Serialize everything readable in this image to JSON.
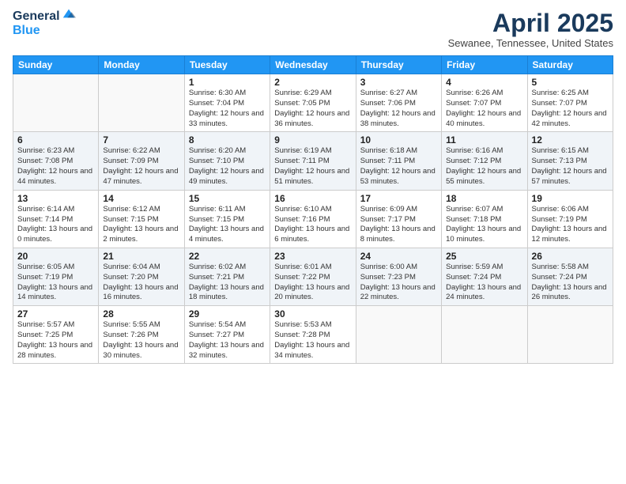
{
  "logo": {
    "general": "General",
    "blue": "Blue"
  },
  "header": {
    "title": "April 2025",
    "subtitle": "Sewanee, Tennessee, United States"
  },
  "weekdays": [
    "Sunday",
    "Monday",
    "Tuesday",
    "Wednesday",
    "Thursday",
    "Friday",
    "Saturday"
  ],
  "weeks": [
    [
      {
        "day": "",
        "info": ""
      },
      {
        "day": "",
        "info": ""
      },
      {
        "day": "1",
        "info": "Sunrise: 6:30 AM\nSunset: 7:04 PM\nDaylight: 12 hours and 33 minutes."
      },
      {
        "day": "2",
        "info": "Sunrise: 6:29 AM\nSunset: 7:05 PM\nDaylight: 12 hours and 36 minutes."
      },
      {
        "day": "3",
        "info": "Sunrise: 6:27 AM\nSunset: 7:06 PM\nDaylight: 12 hours and 38 minutes."
      },
      {
        "day": "4",
        "info": "Sunrise: 6:26 AM\nSunset: 7:07 PM\nDaylight: 12 hours and 40 minutes."
      },
      {
        "day": "5",
        "info": "Sunrise: 6:25 AM\nSunset: 7:07 PM\nDaylight: 12 hours and 42 minutes."
      }
    ],
    [
      {
        "day": "6",
        "info": "Sunrise: 6:23 AM\nSunset: 7:08 PM\nDaylight: 12 hours and 44 minutes."
      },
      {
        "day": "7",
        "info": "Sunrise: 6:22 AM\nSunset: 7:09 PM\nDaylight: 12 hours and 47 minutes."
      },
      {
        "day": "8",
        "info": "Sunrise: 6:20 AM\nSunset: 7:10 PM\nDaylight: 12 hours and 49 minutes."
      },
      {
        "day": "9",
        "info": "Sunrise: 6:19 AM\nSunset: 7:11 PM\nDaylight: 12 hours and 51 minutes."
      },
      {
        "day": "10",
        "info": "Sunrise: 6:18 AM\nSunset: 7:11 PM\nDaylight: 12 hours and 53 minutes."
      },
      {
        "day": "11",
        "info": "Sunrise: 6:16 AM\nSunset: 7:12 PM\nDaylight: 12 hours and 55 minutes."
      },
      {
        "day": "12",
        "info": "Sunrise: 6:15 AM\nSunset: 7:13 PM\nDaylight: 12 hours and 57 minutes."
      }
    ],
    [
      {
        "day": "13",
        "info": "Sunrise: 6:14 AM\nSunset: 7:14 PM\nDaylight: 13 hours and 0 minutes."
      },
      {
        "day": "14",
        "info": "Sunrise: 6:12 AM\nSunset: 7:15 PM\nDaylight: 13 hours and 2 minutes."
      },
      {
        "day": "15",
        "info": "Sunrise: 6:11 AM\nSunset: 7:15 PM\nDaylight: 13 hours and 4 minutes."
      },
      {
        "day": "16",
        "info": "Sunrise: 6:10 AM\nSunset: 7:16 PM\nDaylight: 13 hours and 6 minutes."
      },
      {
        "day": "17",
        "info": "Sunrise: 6:09 AM\nSunset: 7:17 PM\nDaylight: 13 hours and 8 minutes."
      },
      {
        "day": "18",
        "info": "Sunrise: 6:07 AM\nSunset: 7:18 PM\nDaylight: 13 hours and 10 minutes."
      },
      {
        "day": "19",
        "info": "Sunrise: 6:06 AM\nSunset: 7:19 PM\nDaylight: 13 hours and 12 minutes."
      }
    ],
    [
      {
        "day": "20",
        "info": "Sunrise: 6:05 AM\nSunset: 7:19 PM\nDaylight: 13 hours and 14 minutes."
      },
      {
        "day": "21",
        "info": "Sunrise: 6:04 AM\nSunset: 7:20 PM\nDaylight: 13 hours and 16 minutes."
      },
      {
        "day": "22",
        "info": "Sunrise: 6:02 AM\nSunset: 7:21 PM\nDaylight: 13 hours and 18 minutes."
      },
      {
        "day": "23",
        "info": "Sunrise: 6:01 AM\nSunset: 7:22 PM\nDaylight: 13 hours and 20 minutes."
      },
      {
        "day": "24",
        "info": "Sunrise: 6:00 AM\nSunset: 7:23 PM\nDaylight: 13 hours and 22 minutes."
      },
      {
        "day": "25",
        "info": "Sunrise: 5:59 AM\nSunset: 7:24 PM\nDaylight: 13 hours and 24 minutes."
      },
      {
        "day": "26",
        "info": "Sunrise: 5:58 AM\nSunset: 7:24 PM\nDaylight: 13 hours and 26 minutes."
      }
    ],
    [
      {
        "day": "27",
        "info": "Sunrise: 5:57 AM\nSunset: 7:25 PM\nDaylight: 13 hours and 28 minutes."
      },
      {
        "day": "28",
        "info": "Sunrise: 5:55 AM\nSunset: 7:26 PM\nDaylight: 13 hours and 30 minutes."
      },
      {
        "day": "29",
        "info": "Sunrise: 5:54 AM\nSunset: 7:27 PM\nDaylight: 13 hours and 32 minutes."
      },
      {
        "day": "30",
        "info": "Sunrise: 5:53 AM\nSunset: 7:28 PM\nDaylight: 13 hours and 34 minutes."
      },
      {
        "day": "",
        "info": ""
      },
      {
        "day": "",
        "info": ""
      },
      {
        "day": "",
        "info": ""
      }
    ]
  ]
}
